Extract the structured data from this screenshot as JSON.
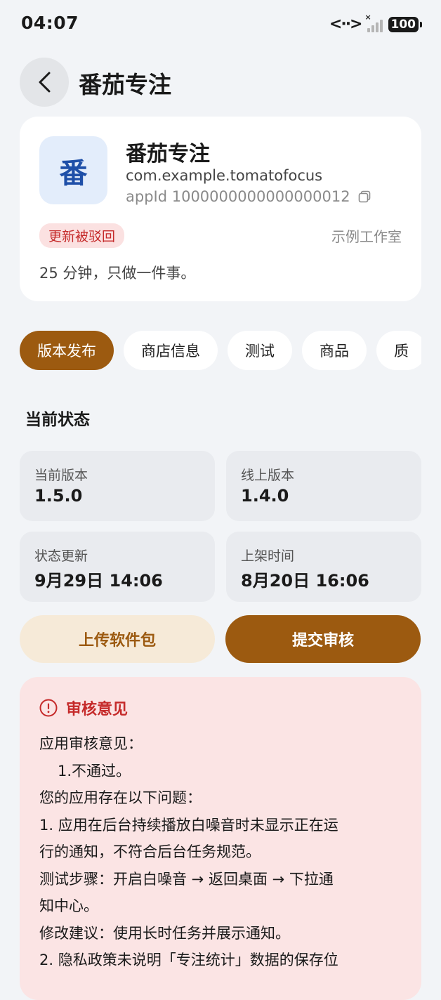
{
  "status_bar": {
    "time": "04:07",
    "battery": "100"
  },
  "header": {
    "title": "番茄专注"
  },
  "app": {
    "icon_char": "番",
    "name": "番茄专注",
    "package": "com.example.tomatofocus",
    "app_id": "appId 1000000000000000012",
    "status_badge": "更新被驳回",
    "developer": "示例工作室",
    "slogan": "25 分钟，只做一件事。"
  },
  "tabs": [
    {
      "label": "版本发布",
      "active": true
    },
    {
      "label": "商店信息"
    },
    {
      "label": "测试"
    },
    {
      "label": "商品"
    },
    {
      "label": "质"
    }
  ],
  "status_section": {
    "title": "当前状态",
    "current_version": {
      "label": "当前版本",
      "value": "1.5.0"
    },
    "online_version": {
      "label": "线上版本",
      "value": "1.4.0"
    },
    "status_updated": {
      "label": "状态更新",
      "value": "9月29日 14:06"
    },
    "listed_time": {
      "label": "上架时间",
      "value": "8月20日 16:06"
    }
  },
  "actions": {
    "upload": "上传软件包",
    "submit": "提交审核"
  },
  "review": {
    "title": "审核意见",
    "lines": [
      "应用审核意见：",
      "1.不通过。",
      "您的应用存在以下问题：",
      "1. 应用在后台持续播放白噪音时未显示正在运",
      "行的通知，不符合后台任务规范。",
      "测试步骤：开启白噪音 → 返回桌面 → 下拉通",
      "知中心。",
      "修改建议：使用长时任务并展示通知。",
      "2. 隐私政策未说明「专注统计」数据的保存位"
    ]
  },
  "colors": {
    "accent": "#9c5a10",
    "danger": "#c52a2a",
    "background": "#f2f4f7"
  }
}
